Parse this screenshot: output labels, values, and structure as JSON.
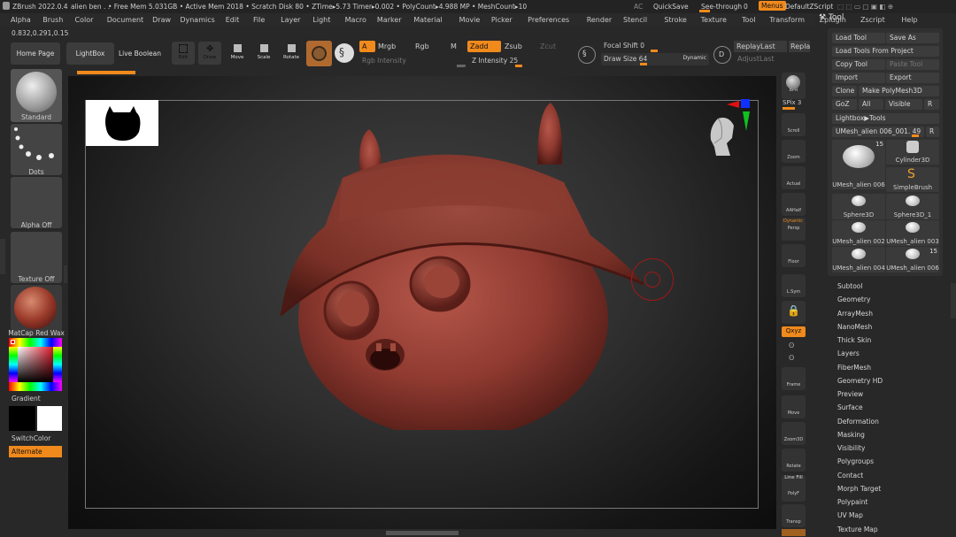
{
  "titlebar": {
    "app": "ZBrush 2022.0.4",
    "doc": "alien ben . .",
    "stats": "• Free Mem 5.031GB • Active Mem 2018 • Scratch Disk 80 • ZTime▸5.73 Timer▸0.002 • PolyCount▸4.988 MP • MeshCount▸10",
    "ac": "AC",
    "quicksave": "QuickSave",
    "seethrough": "See-through",
    "seethrough_value": "0",
    "menus": "Menus",
    "script": "DefaultZScript"
  },
  "menubar": [
    "Alpha",
    "Brush",
    "Color",
    "Document",
    "Draw",
    "Dynamics",
    "Edit",
    "File",
    "Layer",
    "Light",
    "Macro",
    "Marker",
    "Material",
    "Movie",
    "Picker",
    "Preferences",
    "Render",
    "Stencil",
    "Stroke",
    "Texture",
    "Tool",
    "Transform",
    "Zplugin",
    "Zscript",
    "Help"
  ],
  "coords": "0.832,0.291,0.15",
  "shelf": {
    "home": "Home Page",
    "lightbox": "LightBox",
    "liveboolean": "Live Boolean",
    "edit": "Edit",
    "draw": "Draw",
    "move": "Move",
    "scale": "Scale",
    "rotate": "Rotate",
    "a": "A",
    "mrgb": "Mrgb",
    "rgb": "Rgb",
    "m": "M",
    "zadd": "Zadd",
    "zsub": "Zsub",
    "zcut": "Zcut",
    "rgb_intensity": "Rgb Intensity",
    "z_intensity_label": "Z Intensity",
    "z_intensity": "25",
    "focal_label": "Focal Shift",
    "focal": "0",
    "draw_size_label": "Draw Size",
    "draw_size": "64",
    "dynamic": "Dynamic",
    "replaylast": "ReplayLast",
    "replay2": "Repla",
    "adjustlast": "AdjustLast"
  },
  "left": {
    "brush": "Standard",
    "stroke": "Dots",
    "alpha": "Alpha Off",
    "texture": "Texture Off",
    "material": "MatCap Red Wax",
    "gradient": "Gradient",
    "switchcolor": "SwitchColor",
    "alternate": "Alternate"
  },
  "right": {
    "bpr": "BPR",
    "spix_label": "SPix",
    "spix": "3",
    "scroll": "Scroll",
    "zoom": "Zoom",
    "actual": "Actual",
    "aahalf": "AAHalf",
    "persp": "Persp",
    "dynamic": "Dynamic",
    "floor": "Floor",
    "lsym": "L.Sym",
    "lock": "",
    "qxyz": "Qxyz",
    "frame": "Frame",
    "move": "Move",
    "zoom3d": "Zoom3D",
    "rotate": "Rotate",
    "linefill": "Line Fill",
    "polyf": "PolyF",
    "transp": "Transp"
  },
  "tool": {
    "title": "Tool",
    "load": "Load Tool",
    "saveas": "Save As",
    "loadproject": "Load Tools From Project",
    "copy": "Copy Tool",
    "paste": "Paste Tool",
    "import": "Import",
    "export": "Export",
    "clone": "Clone",
    "makepolymesh": "Make PolyMesh3D",
    "goz": "GoZ",
    "all": "All",
    "visible": "Visible",
    "r": "R",
    "lightbox_tools": "Lightbox▶Tools",
    "current": "UMesh_alien 006_001.",
    "current_value": "49",
    "cells": [
      {
        "label": "UMesh_alien 006",
        "badge": "15"
      },
      {
        "label": "Cylinder3D",
        "badge": ""
      },
      {
        "label": "",
        "badge": ""
      },
      {
        "label": "SimpleBrush",
        "badge": ""
      },
      {
        "label": "Sphere3D",
        "badge": ""
      },
      {
        "label": "Sphere3D_1",
        "badge": ""
      },
      {
        "label": "UMesh_alien 002",
        "badge": ""
      },
      {
        "label": "UMesh_alien 003",
        "badge": ""
      },
      {
        "label": "UMesh_alien 004",
        "badge": ""
      },
      {
        "label": "UMesh_alien 006",
        "badge": "15"
      }
    ],
    "subpalettes": [
      "Subtool",
      "Geometry",
      "ArrayMesh",
      "NanoMesh",
      "Thick Skin",
      "Layers",
      "FiberMesh",
      "Geometry HD",
      "Preview",
      "Surface",
      "Deformation",
      "Masking",
      "Visibility",
      "Polygroups",
      "Contact",
      "Morph Target",
      "Polypaint",
      "UV Map",
      "Texture Map"
    ]
  },
  "colors": {
    "accent": "#f08a1c",
    "model": "#8f3a30",
    "background": "#282828"
  }
}
